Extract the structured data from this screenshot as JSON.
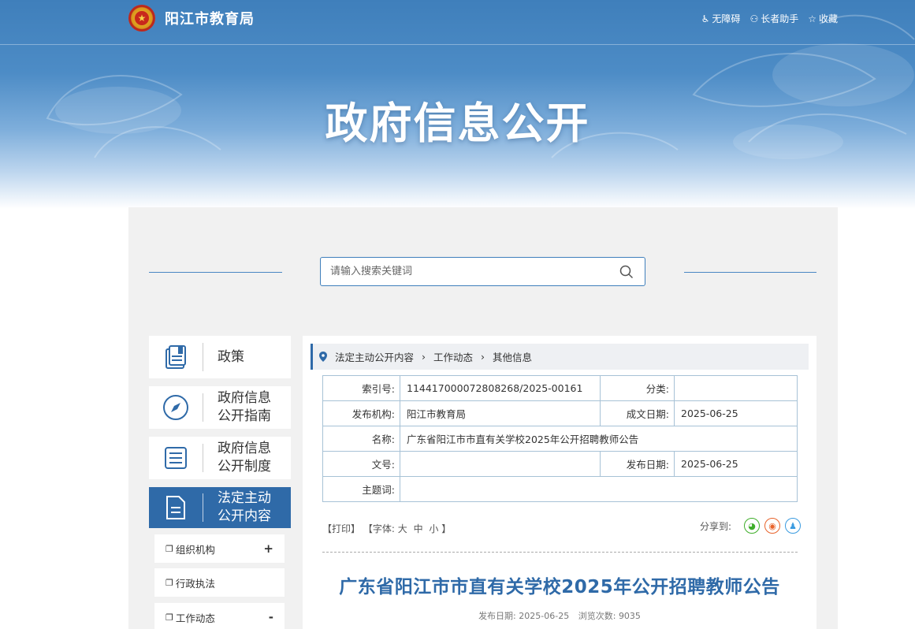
{
  "header": {
    "site_title": "阳江市教育局",
    "links": [
      {
        "icon": "wheelchair-icon",
        "label": "无障碍"
      },
      {
        "icon": "elder-assist-icon",
        "label": "长者助手"
      },
      {
        "icon": "star-icon",
        "label": "收藏"
      }
    ],
    "banner_title": "政府信息公开"
  },
  "search": {
    "placeholder": "请输入搜索关键词",
    "value": ""
  },
  "sidebar": {
    "items": [
      {
        "icon": "book-icon",
        "label": "政策"
      },
      {
        "icon": "compass-icon",
        "label": "政府信息公开指南"
      },
      {
        "icon": "list-document-icon",
        "label": "政府信息公开制度"
      },
      {
        "icon": "document-icon",
        "label": "法定主动公开内容",
        "active": true
      }
    ],
    "subitems": [
      {
        "label": "组织机构",
        "toggle": "+"
      },
      {
        "label": "行政执法",
        "toggle": ""
      },
      {
        "label": "工作动态",
        "toggle": "-"
      }
    ]
  },
  "breadcrumb": [
    "法定主动公开内容",
    "工作动态",
    "其他信息"
  ],
  "meta": {
    "index_no_label": "索引号:",
    "index_no": "114417000072808268/2025-00161",
    "category_label": "分类:",
    "category": "",
    "publisher_label": "发布机构:",
    "publisher": "阳江市教育局",
    "created_label": "成文日期:",
    "created": "2025-06-25",
    "name_label": "名称:",
    "name": "广东省阳江市市直有关学校2025年公开招聘教师公告",
    "doc_no_label": "文号:",
    "doc_no": "",
    "published_label": "发布日期:",
    "published": "2025-06-25",
    "keywords_label": "主题词:",
    "keywords": ""
  },
  "tools": {
    "print": "【打印】",
    "font_prefix": "【字体:",
    "font_large": "大",
    "font_medium": "中",
    "font_small": "小",
    "font_suffix": "】",
    "share_label": "分享到:"
  },
  "article": {
    "title": "广东省阳江市市直有关学校2025年公开招聘教师公告",
    "meta_date_label": "发布日期:",
    "meta_date": "2025-06-25",
    "meta_views_label": "浏览次数:",
    "meta_views": "9035"
  },
  "colors": {
    "primary": "#2f6aa8",
    "title_blue": "#2f6aa8",
    "banner": "#3f7fbb"
  }
}
